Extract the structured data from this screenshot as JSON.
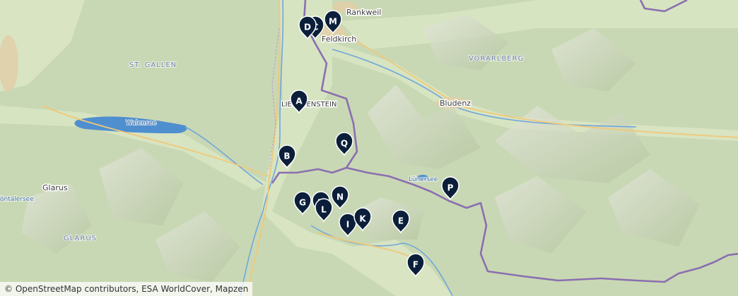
{
  "map": {
    "places": [
      {
        "id": "rankweil",
        "label": "Rankweil"
      },
      {
        "id": "feldkirch",
        "label": "Feldkirch"
      },
      {
        "id": "bludenz",
        "label": "Bludenz"
      },
      {
        "id": "liechtenstein",
        "label": "LIECHTENSTEIN"
      },
      {
        "id": "glarus-town",
        "label": "Glarus"
      }
    ],
    "regions": [
      {
        "id": "st-gallen",
        "label": "ST. GALLEN"
      },
      {
        "id": "vorarlberg",
        "label": "VORARLBERG"
      },
      {
        "id": "glarus-canton",
        "label": "GLARUS"
      }
    ],
    "lakes": [
      {
        "id": "walensee",
        "label": "Walensee"
      },
      {
        "id": "luenersee",
        "label": "Lünersee"
      },
      {
        "id": "kloentalersee",
        "label": "öntalersee"
      }
    ],
    "markers": [
      {
        "letter": "A"
      },
      {
        "letter": "B"
      },
      {
        "letter": "C"
      },
      {
        "letter": "D"
      },
      {
        "letter": "E"
      },
      {
        "letter": "F"
      },
      {
        "letter": "G"
      },
      {
        "letter": "H"
      },
      {
        "letter": "I"
      },
      {
        "letter": "K"
      },
      {
        "letter": "L"
      },
      {
        "letter": "M"
      },
      {
        "letter": "N"
      },
      {
        "letter": "P"
      },
      {
        "letter": "Q"
      }
    ],
    "colors": {
      "terrain": "#c9d8b4",
      "water": "#4f8fcf",
      "border": "#8a6fb0",
      "marker": "#0b1f3a"
    },
    "attribution": "© OpenStreetMap contributors, ESA WorldCover, Mapzen"
  }
}
